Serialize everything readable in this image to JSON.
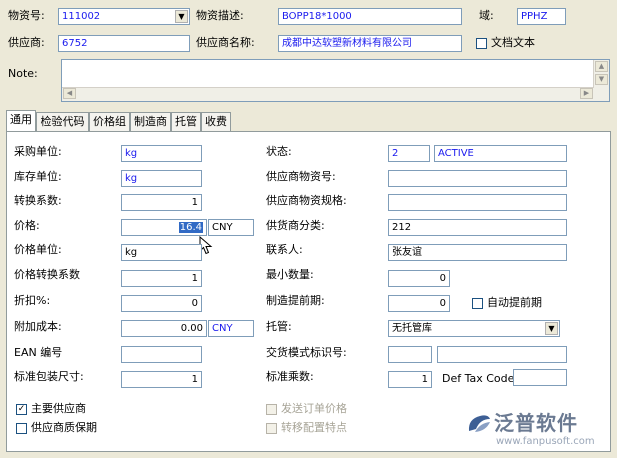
{
  "header": {
    "material_no_label": "物资号:",
    "material_no_value": "111002",
    "material_desc_label": "物资描述:",
    "material_desc_value": "BOPP18*1000",
    "domain_label": "域:",
    "domain_value": "PPHZ",
    "supplier_label": "供应商:",
    "supplier_value": "6752",
    "supplier_name_label": "供应商名称:",
    "supplier_name_value": "成都中达软塑新材料有限公司",
    "doc_text_label": "文档文本",
    "doc_text_checked": false,
    "note_label": "Note:"
  },
  "tabs": [
    {
      "label": "通用",
      "active": true
    },
    {
      "label": "检验代码",
      "active": false
    },
    {
      "label": "价格组",
      "active": false
    },
    {
      "label": "制造商",
      "active": false
    },
    {
      "label": "托管",
      "active": false
    },
    {
      "label": "收费",
      "active": false
    }
  ],
  "left": {
    "purchase_unit_label": "采购单位:",
    "purchase_unit_value": "kg",
    "stock_unit_label": "库存单位:",
    "stock_unit_value": "kg",
    "conv_factor_label": "转换系数:",
    "conv_factor_value": "1",
    "price_label": "价格:",
    "price_value": "16.4",
    "price_currency": "CNY",
    "price_unit_label": "价格单位:",
    "price_unit_value": "kg",
    "price_conv_label": "价格转换系数",
    "price_conv_value": "1",
    "discount_label": "折扣%:",
    "discount_value": "0",
    "extra_cost_label": "附加成本:",
    "extra_cost_value": "0.00",
    "extra_cost_currency": "CNY",
    "ean_label": "EAN 编号",
    "ean_value": "",
    "std_pack_label": "标准包装尺寸:",
    "std_pack_value": "1"
  },
  "right": {
    "status_label": "状态:",
    "status_code": "2",
    "status_text": "ACTIVE",
    "supplier_item_label": "供应商物资号:",
    "supplier_item_value": "",
    "supplier_spec_label": "供应商物资规格:",
    "supplier_spec_value": "",
    "supplier_class_label": "供货商分类:",
    "supplier_class_value": "212",
    "contact_label": "联系人:",
    "contact_value": "张友谊",
    "min_qty_label": "最小数量:",
    "min_qty_value": "0",
    "mfg_lead_label": "制造提前期:",
    "mfg_lead_value": "0",
    "auto_lead_label": "自动提前期",
    "consign_label": "托管:",
    "consign_value": "无托管库",
    "trade_mode_label": "交货模式标识号:",
    "std_mult_label": "标准乘数:",
    "std_mult_value": "1",
    "def_tax_label": "Def Tax Code:",
    "def_tax_value": ""
  },
  "bottom": {
    "main_supplier_label": "主要供应商",
    "main_supplier_checked": true,
    "quality_guarantee_label": "供应商质保期",
    "send_order_price_label": "发送订单价格",
    "transfer_config_label": "转移配置特点"
  },
  "logo": {
    "text": "泛普软件",
    "url": "www.fanpusoft.com"
  }
}
